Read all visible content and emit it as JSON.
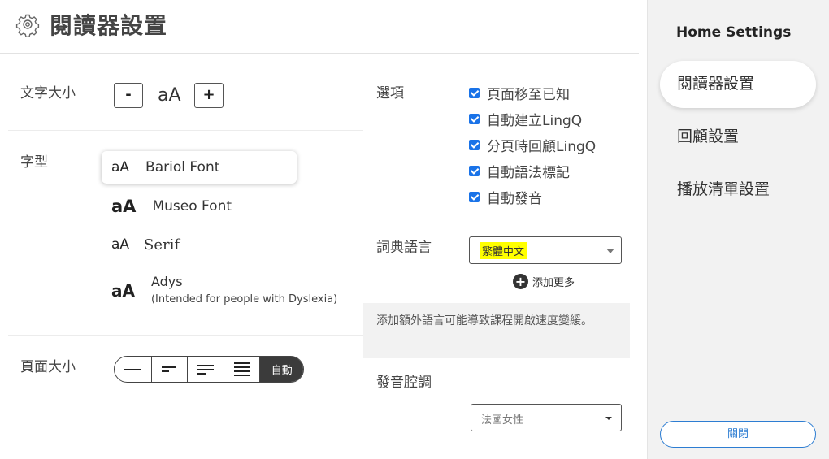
{
  "header": {
    "title": "閱讀器設置",
    "icon": "gear-icon"
  },
  "text_size": {
    "label": "文字大小",
    "decrease_label": "-",
    "sample": "aA",
    "increase_label": "+"
  },
  "font": {
    "label": "字型",
    "options": [
      {
        "aa": "aA",
        "name": "Bariol Font",
        "selected": true
      },
      {
        "aa": "aA",
        "name": "Museo Font",
        "selected": false
      },
      {
        "aa": "aA",
        "name": "Serif",
        "selected": false
      },
      {
        "aa": "aA",
        "name": "Adys",
        "note": "(Intended for people with Dyslexia)",
        "selected": false
      }
    ]
  },
  "page_size": {
    "label": "頁面大小",
    "auto_label": "自動",
    "selected": "auto"
  },
  "options": {
    "label": "選項",
    "items": [
      {
        "label": "頁面移至已知",
        "checked": true
      },
      {
        "label": "自動建立LingQ",
        "checked": true
      },
      {
        "label": "分頁時回顧LingQ",
        "checked": true
      },
      {
        "label": "自動語法標記",
        "checked": true
      },
      {
        "label": "自動發音",
        "checked": true
      }
    ]
  },
  "dictionary_language": {
    "label": "詞典語言",
    "value": "繁體中文",
    "highlight_color": "#ffff00",
    "add_more": "添加更多"
  },
  "note": "添加額外語言可能導致課程開啟速度變緩。",
  "accent": {
    "label": "發音腔調",
    "value": "法國女性"
  },
  "sidebar": {
    "title": "Home Settings",
    "items": [
      {
        "label": "閱讀器設置",
        "active": true
      },
      {
        "label": "回顧設置",
        "active": false
      },
      {
        "label": "播放清單設置",
        "active": false
      }
    ],
    "close_label": "關閉"
  },
  "colors": {
    "accent_blue": "#2d7dd2",
    "checkbox_blue": "#1a73e8",
    "segment_active": "#3b3b3b"
  }
}
